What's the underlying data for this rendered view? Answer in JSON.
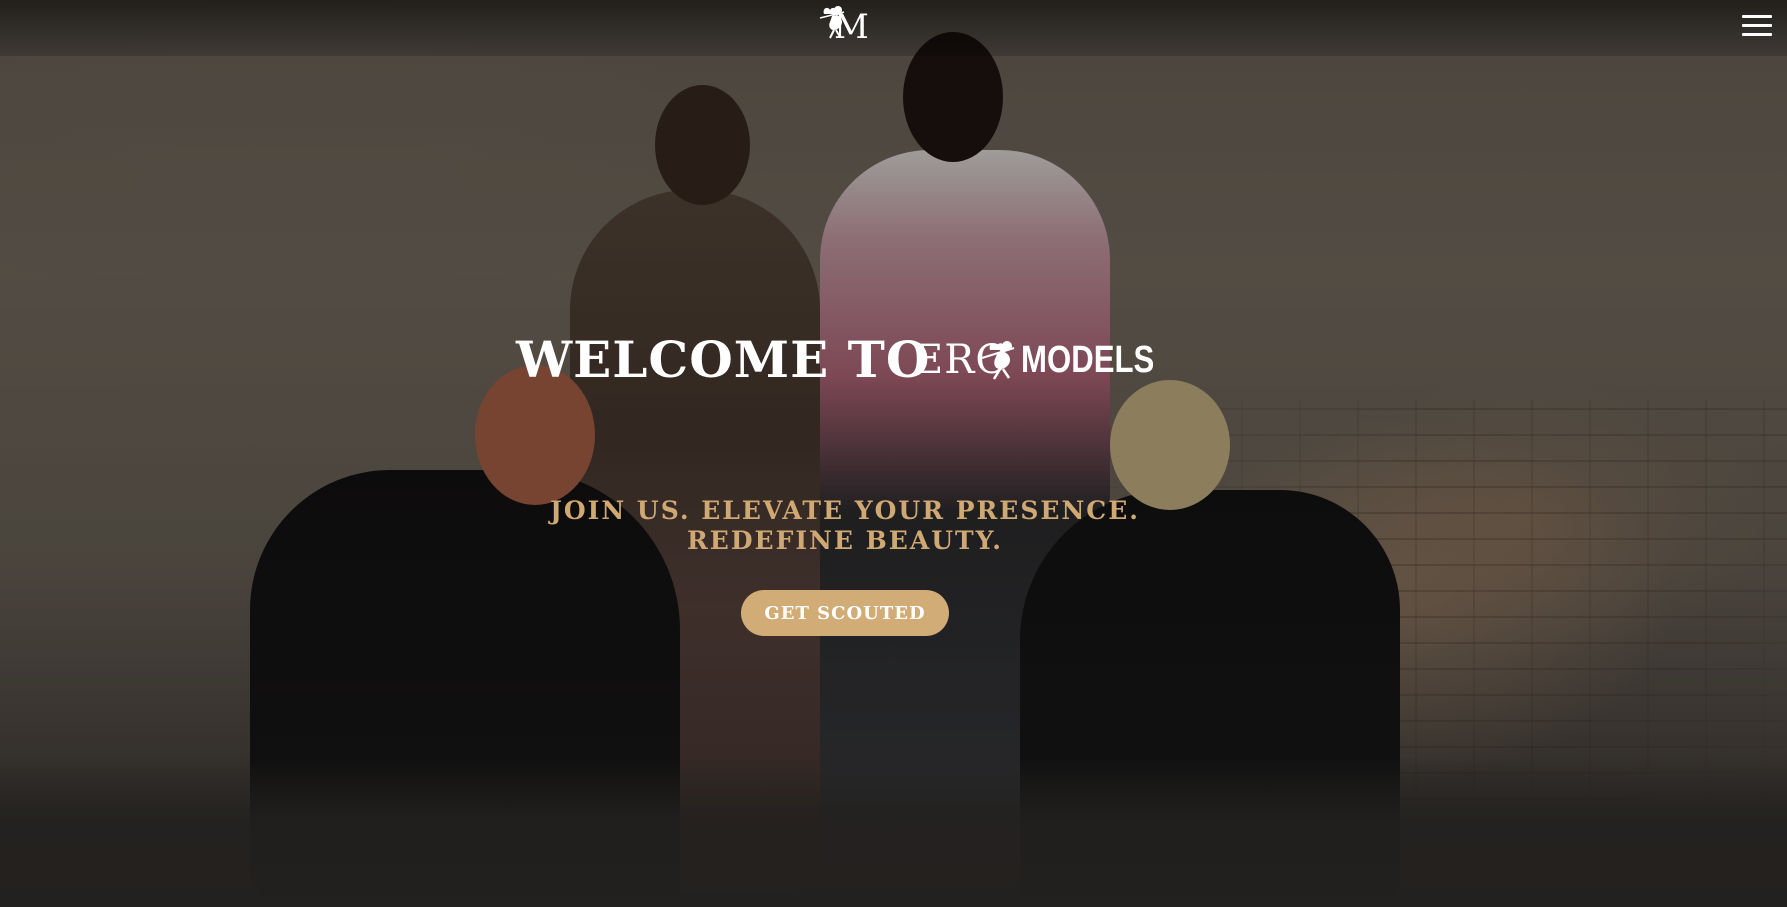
{
  "header": {
    "logo_letter": "M",
    "logo_icon": "cupid-icon",
    "menu_icon": "hamburger-menu-icon"
  },
  "hero": {
    "headline": "WELCOME TO",
    "wordmark_left": "ERO",
    "wordmark_icon": "cupid-icon",
    "wordmark_right": "MODELS",
    "tagline": "JOIN US. ELEVATE YOUR PRESENCE. REDEFINE BEAUTY.",
    "cta_label": "GET SCOUTED"
  },
  "colors": {
    "accent_gold": "#d1ac76",
    "tagline_gold": "#cfa874",
    "text_white": "#ffffff"
  }
}
